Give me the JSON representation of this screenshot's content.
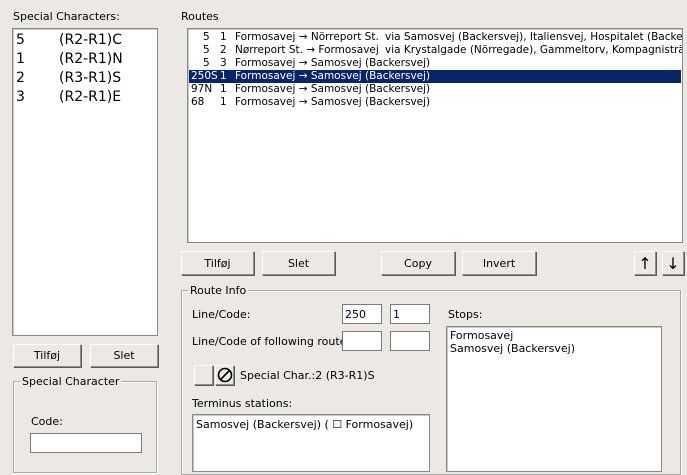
{
  "special": {
    "title": "Special Characters:",
    "items": [
      {
        "num": "5",
        "code": "(R2-R1)C"
      },
      {
        "num": "1",
        "code": "(R2-R1)N"
      },
      {
        "num": "2",
        "code": "(R3-R1)S"
      },
      {
        "num": "3",
        "code": "(R2-R1)E"
      }
    ],
    "add_label": "Tilføj",
    "delete_label": "Slet",
    "group_title": "Special Character",
    "code_label": "Code:",
    "code_value": ""
  },
  "routes": {
    "title": "Routes",
    "rows": [
      {
        "line": "5",
        "code": "1",
        "route": "Formosavej → Nörreport St.",
        "via": "via Samosvej (Backersvej), Italiensvej, Hospitalet (Backersvej)",
        "selected": false
      },
      {
        "line": "5",
        "code": "2",
        "route": "Nørreport St. → Formosavej",
        "via": "via Krystalgade (Nörregade), Gammeltorv, Kompagnisträde (R",
        "selected": false
      },
      {
        "line": "5",
        "code": "3",
        "route": "Formosavej → Samosvej (Backersvej)",
        "via": "",
        "selected": false
      },
      {
        "line": "250S",
        "code": "1",
        "route": "Formosavej → Samosvej (Backersvej)",
        "via": "",
        "selected": true
      },
      {
        "line": "97N",
        "code": "1",
        "route": "Formosavej → Samosvej (Backersvej)",
        "via": "",
        "selected": false
      },
      {
        "line": "68",
        "code": "1",
        "route": "Formosavej → Samosvej (Backersvej)",
        "via": "",
        "selected": false
      }
    ],
    "add_label": "Tilføj",
    "delete_label": "Slet",
    "copy_label": "Copy",
    "invert_label": "Invert",
    "up_icon": "↑",
    "down_icon": "↓"
  },
  "route_info": {
    "title": "Route Info",
    "line_code_label": "Line/Code:",
    "line_value": "250",
    "code_value": "1",
    "following_label": "Line/Code of following route:",
    "following_line": "",
    "following_code": "",
    "special_char_label": "Special Char.:2  (R3-R1)S",
    "terminus_label": "Terminus stations:",
    "terminus_text": "Samosvej (Backersvej) ( ☐ Formosavej)",
    "stops_label": "Stops:",
    "stops": [
      "Formosavej",
      "Samosvej (Backersvej)"
    ]
  }
}
